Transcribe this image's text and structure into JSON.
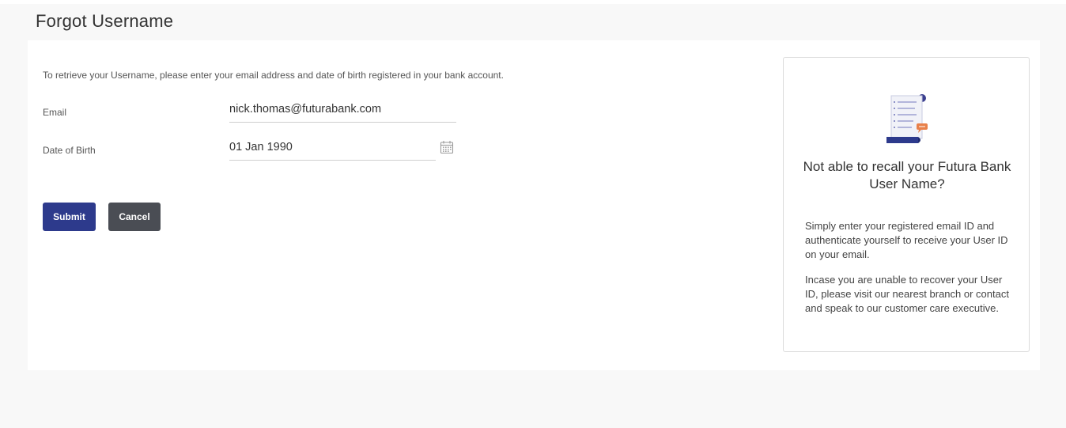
{
  "page": {
    "title": "Forgot Username"
  },
  "form": {
    "intro": "To retrieve your Username, please enter your email address and date of birth registered in your bank account.",
    "email_label": "Email",
    "email_value": "nick.thomas@futurabank.com",
    "dob_label": "Date of Birth",
    "dob_value": "01 Jan 1990",
    "submit_label": "Submit",
    "cancel_label": "Cancel"
  },
  "help": {
    "title": "Not able to recall your Futura Bank User Name?",
    "paragraph1": "Simply enter your registered email ID and authenticate yourself to receive your User ID on your email.",
    "paragraph2": "Incase you are unable to recover your User ID, please visit our nearest branch or contact and speak to our customer care executive."
  },
  "icons": {
    "calendar": "calendar-icon",
    "illustration": "document-scroll-icon"
  },
  "colors": {
    "primary": "#2d3a8c",
    "secondary": "#4a4d54",
    "accent": "#e8804a"
  }
}
